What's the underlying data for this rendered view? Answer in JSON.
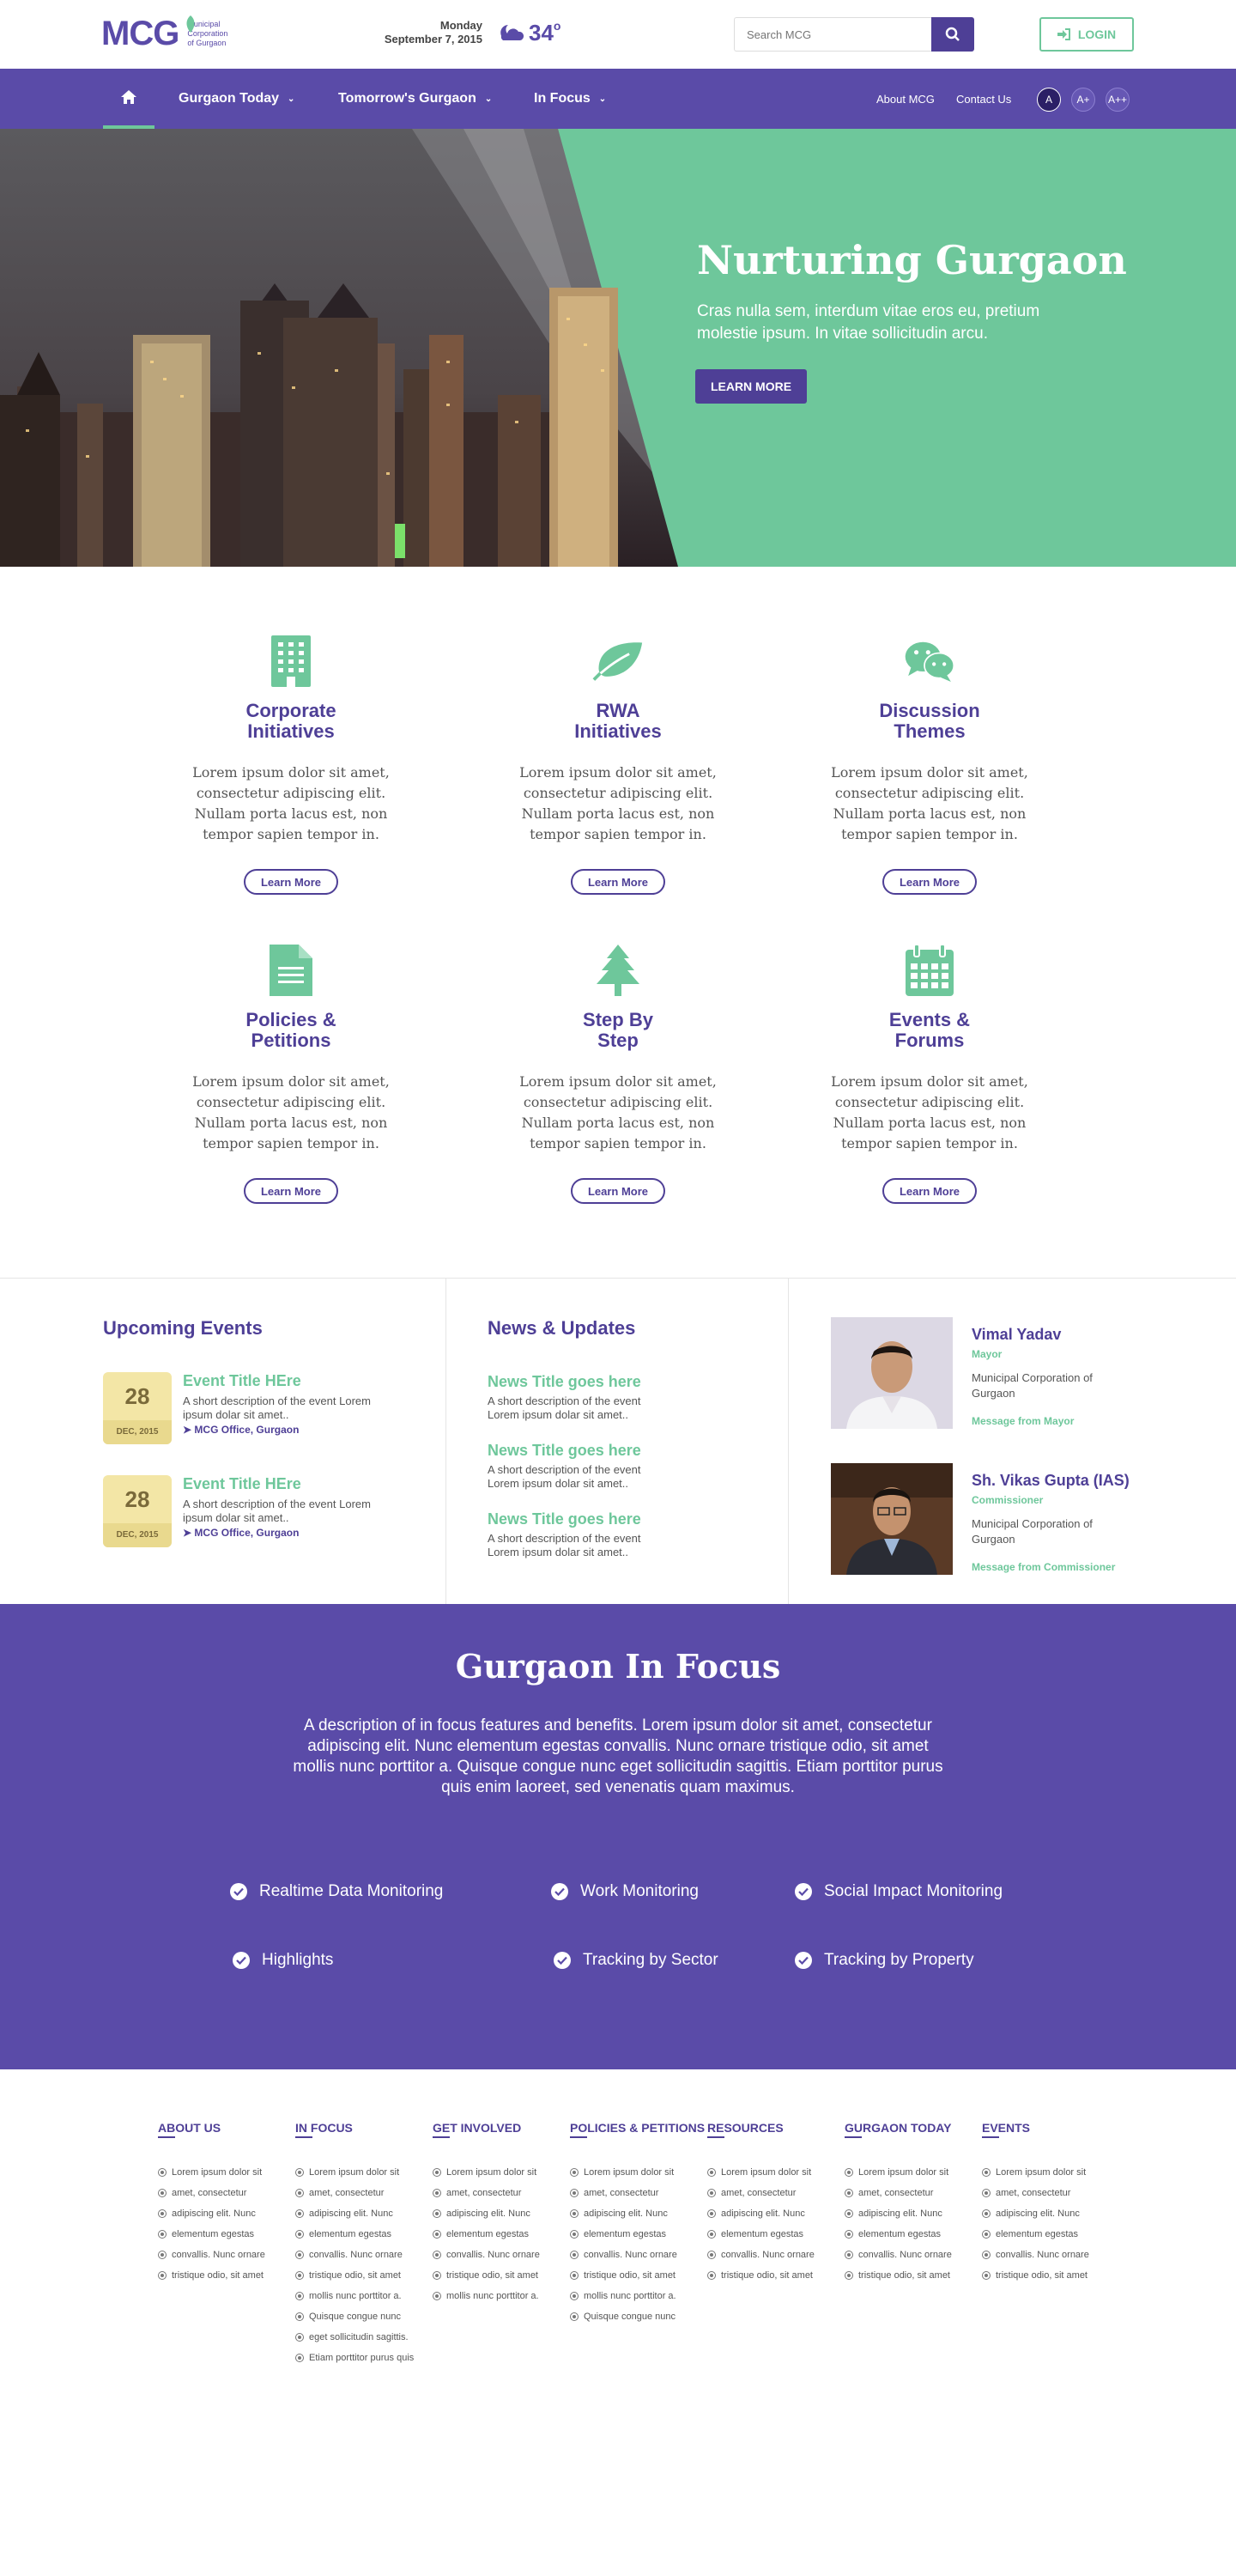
{
  "header": {
    "logo_text": "MCG",
    "logo_sub": [
      "Municipal",
      "Corporation",
      "of Gurgaon"
    ],
    "date_day": "Monday",
    "date_full": "September 7, 2015",
    "weather_temp": "34",
    "weather_unit": "o",
    "search_placeholder": "Search MCG",
    "login_label": "LOGIN"
  },
  "nav": {
    "items": [
      {
        "label": "Gurgaon Today"
      },
      {
        "label": "Tomorrow's Gurgaon"
      },
      {
        "label": "In Focus"
      }
    ],
    "about": "About MCG",
    "contact": "Contact Us",
    "font_buttons": [
      "A",
      "A+",
      "A++"
    ]
  },
  "hero": {
    "title": "Nurturing Gurgaon",
    "subtitle": "Cras nulla sem, interdum vitae eros eu, pretium molestie ipsum. In vitae sollicitudin arcu.",
    "button": "LEARN MORE"
  },
  "features": [
    {
      "icon": "building-icon",
      "title": "Corporate Initiatives",
      "desc": "Lorem ipsum dolor sit amet, consectetur adipiscing elit. Nullam porta lacus est, non tempor sapien tempor in.",
      "button": "Learn More"
    },
    {
      "icon": "leaf-icon",
      "title": "RWA Initiatives",
      "desc": "Lorem ipsum dolor sit amet, consectetur adipiscing elit. Nullam porta lacus est, non tempor sapien tempor in.",
      "button": "Learn More"
    },
    {
      "icon": "chat-icon",
      "title": "Discussion Themes",
      "desc": "Lorem ipsum dolor sit amet, consectetur adipiscing elit. Nullam porta lacus est, non tempor sapien tempor in.",
      "button": "Learn More"
    },
    {
      "icon": "document-icon",
      "title": "Policies & Petitions",
      "desc": "Lorem ipsum dolor sit amet, consectetur adipiscing elit. Nullam porta lacus est, non tempor sapien tempor in.",
      "button": "Learn More"
    },
    {
      "icon": "tree-icon",
      "title": "Step By Step",
      "desc": "Lorem ipsum dolor sit amet, consectetur adipiscing elit. Nullam porta lacus est, non tempor sapien tempor in.",
      "button": "Learn More"
    },
    {
      "icon": "calendar-icon",
      "title": "Events & Forums",
      "desc": "Lorem ipsum dolor sit amet, consectetur adipiscing elit. Nullam porta lacus est, non tempor sapien tempor in.",
      "button": "Learn More"
    }
  ],
  "events": {
    "title": "Upcoming Events",
    "items": [
      {
        "day": "28",
        "month": "DEC, 2015",
        "title": "Event Title HEre",
        "desc": "A short description of the event Lorem ipsum dolar sit amet..",
        "location": "MCG Office, Gurgaon"
      },
      {
        "day": "28",
        "month": "DEC, 2015",
        "title": "Event Title HEre",
        "desc": "A short description of the event Lorem ipsum dolar sit amet..",
        "location": "MCG Office, Gurgaon"
      }
    ]
  },
  "news": {
    "title": "News & Updates",
    "items": [
      {
        "title": "News Title goes here",
        "desc": "A short description of the event Lorem ipsum dolar sit amet.."
      },
      {
        "title": "News Title goes here",
        "desc": "A short description of the event Lorem ipsum dolar sit amet.."
      },
      {
        "title": "News Title goes here",
        "desc": "A short description of the event Lorem ipsum dolar sit amet.."
      }
    ]
  },
  "people": [
    {
      "name": "Vimal Yadav",
      "role": "Mayor",
      "org": "Municipal Corporation of Gurgaon",
      "message": "Message from Mayor"
    },
    {
      "name": "Sh. Vikas Gupta (IAS)",
      "role": "Commissioner",
      "org": "Municipal Corporation of Gurgaon",
      "message": "Message from Commissioner"
    }
  ],
  "focus": {
    "title": "Gurgaon In Focus",
    "desc": "A description of in focus features and benefits. Lorem ipsum dolor sit amet, consectetur adipiscing elit. Nunc elementum egestas convallis. Nunc ornare tristique odio, sit amet mollis nunc porttitor a. Quisque congue nunc eget sollicitudin sagittis. Etiam porttitor purus quis enim laoreet, sed venenatis quam maximus.",
    "items": [
      "Realtime Data Monitoring",
      "Work Monitoring",
      "Social Impact Monitoring",
      "Highlights",
      "Tracking by Sector",
      "Tracking by Property"
    ]
  },
  "footer": [
    {
      "title": "ABOUT US",
      "items": [
        "Lorem ipsum dolor sit",
        "amet, consectetur",
        "adipiscing elit. Nunc",
        "elementum egestas",
        "convallis. Nunc ornare",
        "tristique odio, sit amet"
      ]
    },
    {
      "title": "IN FOCUS",
      "items": [
        "Lorem ipsum dolor sit",
        "amet, consectetur",
        "adipiscing elit. Nunc",
        "elementum egestas",
        "convallis. Nunc ornare",
        "tristique odio, sit amet",
        "mollis nunc porttitor a.",
        "Quisque congue nunc",
        "eget sollicitudin sagittis.",
        "Etiam porttitor purus quis"
      ]
    },
    {
      "title": "GET INVOLVED",
      "items": [
        "Lorem ipsum dolor sit",
        "amet, consectetur",
        "adipiscing elit. Nunc",
        "elementum egestas",
        "convallis. Nunc ornare",
        "tristique odio, sit amet",
        "mollis nunc porttitor a."
      ]
    },
    {
      "title": "POLICIES & PETITIONS",
      "items": [
        "Lorem ipsum dolor sit",
        "amet, consectetur",
        "adipiscing elit. Nunc",
        "elementum egestas",
        "convallis. Nunc ornare",
        "tristique odio, sit amet",
        "mollis nunc porttitor a.",
        "Quisque congue nunc"
      ]
    },
    {
      "title": "RESOURCES",
      "items": [
        "Lorem ipsum dolor sit",
        "amet, consectetur",
        "adipiscing elit. Nunc",
        "elementum egestas",
        "convallis. Nunc ornare",
        "tristique odio, sit amet"
      ]
    },
    {
      "title": "GURGAON TODAY",
      "items": [
        "Lorem ipsum dolor sit",
        "amet, consectetur",
        "adipiscing elit. Nunc",
        "elementum egestas",
        "convallis. Nunc ornare",
        "tristique odio, sit amet"
      ]
    },
    {
      "title": "EVENTS",
      "items": [
        "Lorem ipsum dolor sit",
        "amet, consectetur",
        "adipiscing elit. Nunc",
        "elementum egestas",
        "convallis. Nunc ornare",
        "tristique odio, sit amet"
      ]
    }
  ],
  "colors": {
    "primary": "#5a4ba8",
    "accent": "#6ec79b",
    "dark_primary": "#4e3f96"
  }
}
